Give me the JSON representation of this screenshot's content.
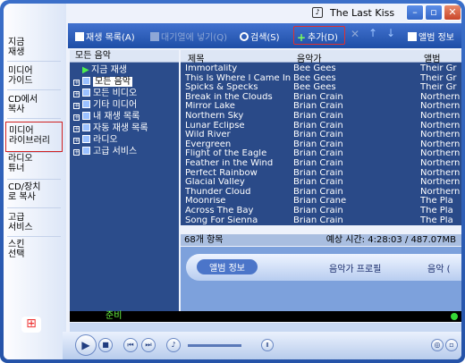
{
  "window": {
    "title": "The Last Kiss",
    "controls": [
      "–",
      "▫",
      "✕"
    ]
  },
  "nav": [
    {
      "label": "지금\n재생",
      "selected": false
    },
    {
      "label": "미디어\n가이드",
      "selected": false
    },
    {
      "label": "CD에서\n복사",
      "selected": false
    },
    {
      "label": "미디어\n라이브러리",
      "selected": true
    },
    {
      "label": "라디오\n튜너",
      "selected": false
    },
    {
      "label": "CD/장치\n로 복사",
      "selected": false
    },
    {
      "label": "고급\n서비스",
      "selected": false
    },
    {
      "label": "스킨\n선택",
      "selected": false
    }
  ],
  "toolbar": {
    "playlist": "재생 목록(A)",
    "queue": "대기열에 넣기(Q)",
    "search": "검색(S)",
    "add": "추가(D)",
    "album_info": "앨범 정보"
  },
  "tree": {
    "header": "모든 음악",
    "items": [
      {
        "label": "지금 재생",
        "expand": "",
        "selected": false
      },
      {
        "label": "모든 음악",
        "expand": "+",
        "selected": true
      },
      {
        "label": "모든 비디오",
        "expand": "+",
        "selected": false
      },
      {
        "label": "기타 미디어",
        "expand": "+",
        "selected": false
      },
      {
        "label": "내 재생 목록",
        "expand": "+",
        "selected": false
      },
      {
        "label": "자동 재생 목록",
        "expand": "+",
        "selected": false
      },
      {
        "label": "라디오",
        "expand": "+",
        "selected": false
      },
      {
        "label": "고급 서비스",
        "expand": "+",
        "selected": false
      }
    ]
  },
  "list": {
    "columns": [
      "제목",
      "음악가",
      "앨범"
    ],
    "rows": [
      [
        "Immortality",
        "Bee Gees",
        "Their Gr"
      ],
      [
        "This Is Where I Came In",
        "Bee Gees",
        "Their Gr"
      ],
      [
        "Spicks & Specks",
        "Bee Gees",
        "Their Gr"
      ],
      [
        "Break in the Clouds",
        "Brian Crain",
        "Northern"
      ],
      [
        "Mirror Lake",
        "Brian Crain",
        "Northern"
      ],
      [
        "Northern Sky",
        "Brian Crain",
        "Northern"
      ],
      [
        "Lunar Eclipse",
        "Brian Crain",
        "Northern"
      ],
      [
        "Wild River",
        "Brian Crain",
        "Northern"
      ],
      [
        "Evergreen",
        "Brian Crain",
        "Northern"
      ],
      [
        "Flight of the Eagle",
        "Brian Crain",
        "Northern"
      ],
      [
        "Feather in the Wind",
        "Brian Crain",
        "Northern"
      ],
      [
        "Perfect Rainbow",
        "Brian Crain",
        "Northern"
      ],
      [
        "Glacial Valley",
        "Brian Crain",
        "Northern"
      ],
      [
        "Thunder Cloud",
        "Brian Crain",
        "Northern"
      ],
      [
        "Moonrise",
        "Brian Crane",
        "The Pla"
      ],
      [
        "Across The Bay",
        "Brian Crain",
        "The Pla"
      ],
      [
        "Song For Sienna",
        "Brian Crain",
        "The Pla"
      ]
    ]
  },
  "status": {
    "count": "68개 항목",
    "time": "예상 시간: 4:28:03 / 487.07MB"
  },
  "info_tabs": {
    "album": "앨범 정보",
    "artist": "음악가 프로필",
    "third": "음악 ("
  },
  "bottom": {
    "status": "준비"
  }
}
